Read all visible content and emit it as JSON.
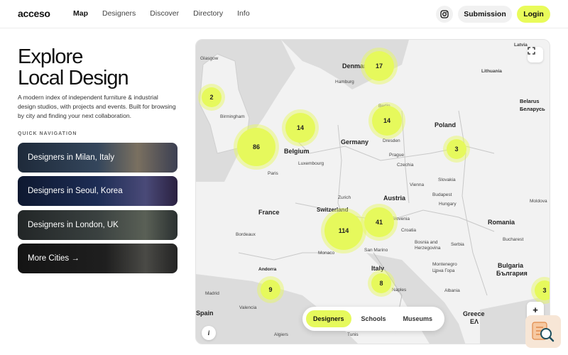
{
  "header": {
    "logo": "acceso",
    "nav": [
      "Map",
      "Designers",
      "Discover",
      "Directory",
      "Info"
    ],
    "active_nav": "Map",
    "submission_label": "Submission",
    "login_label": "Login"
  },
  "hero": {
    "title_line1": "Explore",
    "title_line2": "Local Design",
    "description": "A modern index of independent furniture & industrial design studios, with projects and events. Built for browsing by city and finding your next collaboration.",
    "quick_nav_label": "QUICK NAVIGATION"
  },
  "quick_nav": [
    "Designers in Milan, Italy",
    "Designers in Seoul, Korea",
    "Designers in London, UK",
    "More Cities →"
  ],
  "map": {
    "countries": [
      "Denmark",
      "Latvia",
      "Lithuania",
      "Belarus",
      "Беларусь",
      "Belgium",
      "Germany",
      "Poland",
      "Luxembourg",
      "Czechia",
      "Slovakia",
      "Austria",
      "Hungary",
      "France",
      "Switzerland",
      "Slovenia",
      "Croatia",
      "Romania",
      "Bosnia and Herzegovina",
      "Serbia",
      "Montenegro",
      "Црна Гора",
      "Italy",
      "Bulgaria",
      "България",
      "Albania",
      "Greece",
      "ΕΛ",
      "Spain",
      "Moldova"
    ],
    "cities": [
      "Glasgow",
      "Birmingham",
      "Paris",
      "Bordeaux",
      "Andorra",
      "Madrid",
      "Valencia",
      "Monaco",
      "San Marino",
      "Dresden",
      "Prague",
      "Vienna",
      "Budapest",
      "Bucharest",
      "Naples",
      "Algiers",
      "Tunis",
      "Zurich",
      "Hamburg",
      "Berlin"
    ],
    "clusters": [
      {
        "count": "17"
      },
      {
        "count": "2"
      },
      {
        "count": "14"
      },
      {
        "count": "14"
      },
      {
        "count": "86"
      },
      {
        "count": "3"
      },
      {
        "count": "114"
      },
      {
        "count": "41"
      },
      {
        "count": "9"
      },
      {
        "count": "8"
      },
      {
        "count": "3"
      }
    ],
    "filters": [
      "Designers",
      "Schools",
      "Museums"
    ],
    "active_filter": "Designers",
    "zoom_in": "+",
    "zoom_out": "−",
    "info": "i"
  },
  "icons": {
    "instagram": "instagram-icon",
    "expand": "fullscreen-icon",
    "corner": "search-document-icon"
  },
  "colors": {
    "accent": "#e6f95c",
    "map_background": "#f3f3f3"
  }
}
